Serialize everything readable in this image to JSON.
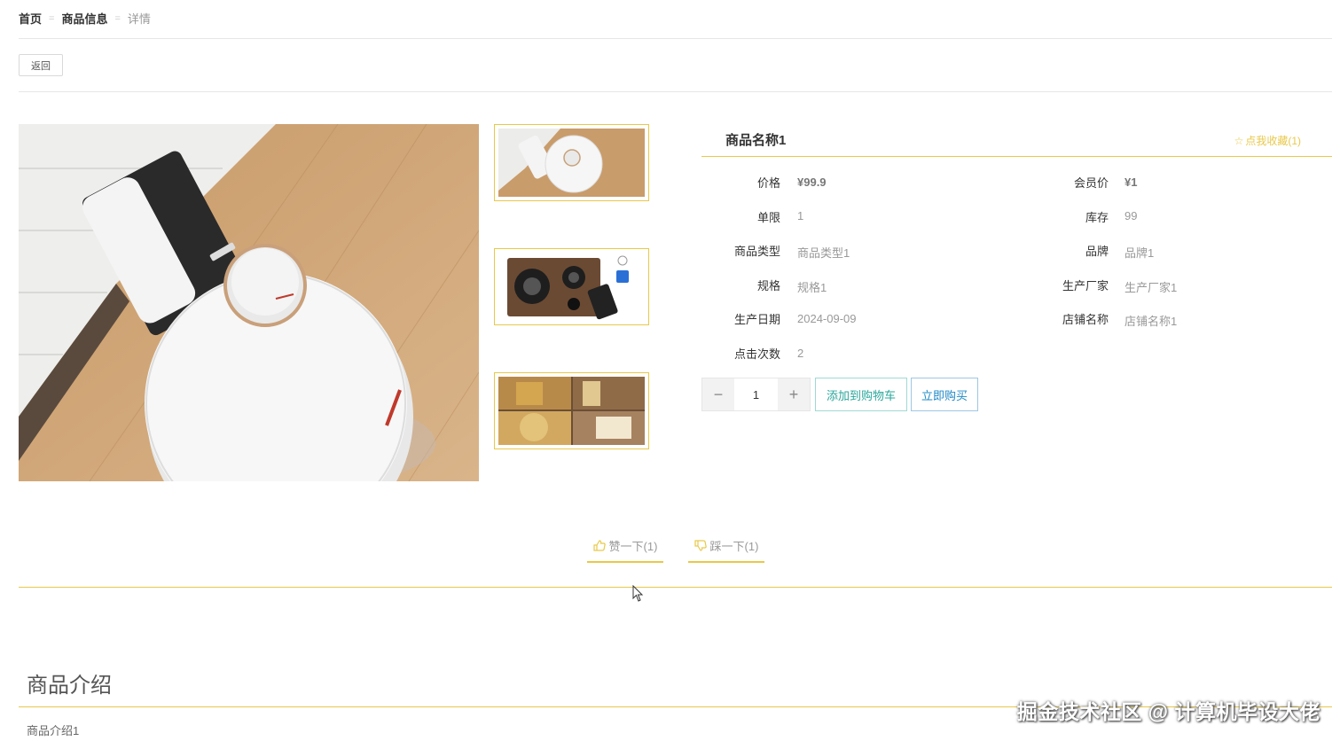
{
  "breadcrumb": {
    "home": "首页",
    "sep1": "=",
    "section": "商品信息",
    "sep2": "=",
    "current": "详情"
  },
  "back_label": "返回",
  "product": {
    "name": "商品名称1",
    "favorite_label": "点我收藏(1)",
    "fields": {
      "price_label": "价格",
      "price_value": "¥99.9",
      "member_price_label": "会员价",
      "member_price_value": "¥1",
      "limit_label": "单限",
      "limit_value": "1",
      "stock_label": "库存",
      "stock_value": "99",
      "type_label": "商品类型",
      "type_value": "商品类型1",
      "brand_label": "品牌",
      "brand_value": "品牌1",
      "spec_label": "规格",
      "spec_value": "规格1",
      "maker_label": "生产厂家",
      "maker_value": "生产厂家1",
      "date_label": "生产日期",
      "date_value": "2024-09-09",
      "shop_label": "店铺名称",
      "shop_value": "店铺名称1",
      "clicks_label": "点击次数",
      "clicks_value": "2"
    },
    "quantity": "1",
    "minus_label": "−",
    "plus_label": "+",
    "add_cart_label": "添加到购物车",
    "buy_now_label": "立即购买"
  },
  "votes": {
    "like_label": "赞一下(1)",
    "dislike_label": "踩一下(1)"
  },
  "intro": {
    "title": "商品介绍",
    "text": "商品介绍1"
  },
  "watermark": "掘金技术社区 @ 计算机毕设大佬",
  "colors": {
    "accent_gold": "#e8c94a",
    "teal": "#2aa79b",
    "blue": "#1e88c7"
  }
}
